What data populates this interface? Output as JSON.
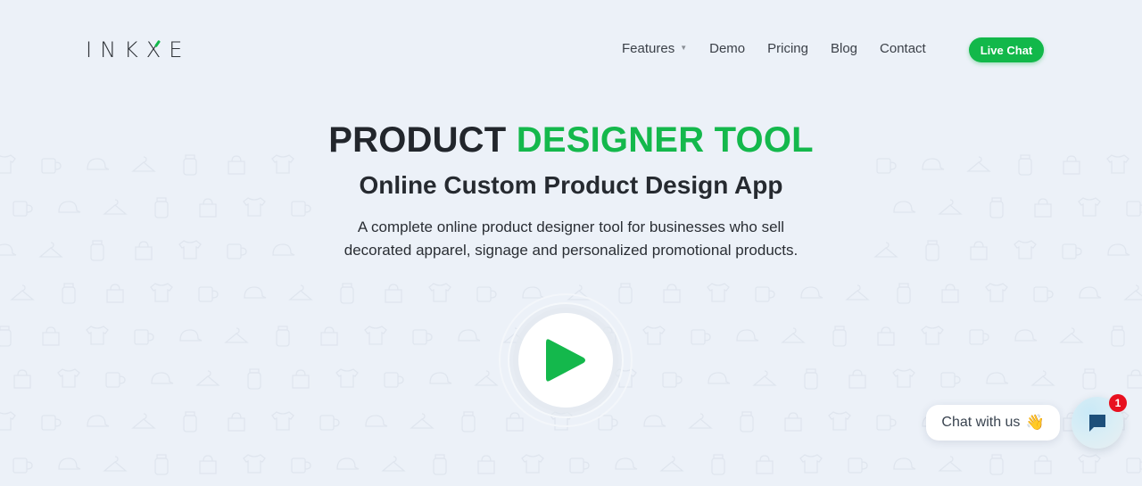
{
  "header": {
    "logo": "INKXE",
    "nav": [
      {
        "label": "Features",
        "has_dropdown": true
      },
      {
        "label": "Demo"
      },
      {
        "label": "Pricing"
      },
      {
        "label": "Blog"
      },
      {
        "label": "Contact"
      }
    ],
    "live_chat_label": "Live Chat"
  },
  "hero": {
    "title_dark": "PRODUCT",
    "title_accent": "DESIGNER TOOL",
    "subtitle": "Online Custom Product Design App",
    "description_line1": "A complete online product designer tool for businesses who sell",
    "description_line2": "decorated apparel, signage and personalized promotional products."
  },
  "play_button": {
    "icon": "play-icon"
  },
  "chat_widget": {
    "bubble_text": "Chat with us",
    "bubble_emoji": "👋",
    "launcher_icon": "chat-icon",
    "unread_count": "1"
  },
  "colors": {
    "accent": "#14b84c",
    "background": "#ecf1f8",
    "badge": "#e8101f",
    "chat_icon": "#1d4f7a"
  }
}
